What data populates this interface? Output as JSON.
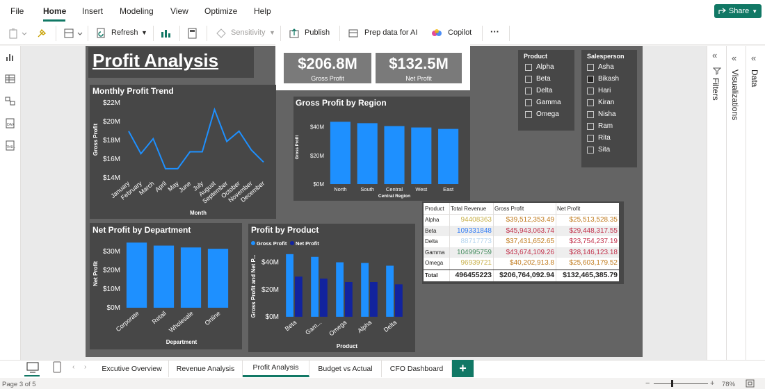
{
  "menu": {
    "items": [
      "File",
      "Home",
      "Insert",
      "Modeling",
      "View",
      "Optimize",
      "Help"
    ],
    "share_label": "Share"
  },
  "toolbar": {
    "refresh_label": "Refresh",
    "sensitivity_label": "Sensitivity",
    "publish_label": "Publish",
    "prep_label": "Prep data for AI",
    "copilot_label": "Copilot",
    "more_label": "···"
  },
  "report": {
    "title": "Profit Analysis",
    "cards": [
      {
        "value": "$206.8M",
        "label": "Gross Profit"
      },
      {
        "value": "$132.5M",
        "label": "Net Profit"
      }
    ],
    "slicer_product": {
      "title": "Product",
      "items": [
        "Alpha",
        "Beta",
        "Delta",
        "Gamma",
        "Omega"
      ]
    },
    "slicer_salesperson": {
      "title": "Salesperson",
      "items": [
        "Asha",
        "Bikash",
        "Hari",
        "Kiran",
        "Nisha",
        "Ram",
        "Rita",
        "Sita"
      ],
      "selected": "Bikash"
    },
    "table": {
      "headers": [
        "Product",
        "Total Revenue",
        "Gross Profit",
        "Net Profit"
      ],
      "rows": [
        [
          "Alpha",
          "94408363",
          "$39,512,353.49",
          "$25,513,528.35"
        ],
        [
          "Beta",
          "109331848",
          "$45,943,063.74",
          "$29,448,317.55"
        ],
        [
          "Delta",
          "88717773",
          "$37,431,652.65",
          "$23,754,237.19"
        ],
        [
          "Gamma",
          "104995759",
          "$43,674,109.26",
          "$28,146,123.18"
        ],
        [
          "Omega",
          "96939721",
          "$40,202,913.8",
          "$25,603,179.52"
        ]
      ],
      "total": [
        "Total",
        "496455223",
        "$206,764,092.94",
        "$132,465,385.79"
      ]
    }
  },
  "chart_data": [
    {
      "type": "line",
      "title": "Monthly Profit Trend",
      "xlabel": "Month",
      "ylabel": "Gross Profit",
      "categories": [
        "January",
        "February",
        "March",
        "April",
        "May",
        "June",
        "July",
        "August",
        "September",
        "October",
        "November",
        "December"
      ],
      "values": [
        18.9,
        16.5,
        18.1,
        14.9,
        14.9,
        16.7,
        16.7,
        21.2,
        17.8,
        18.9,
        16.9,
        15.6
      ],
      "yticks": [
        "$14M",
        "$16M",
        "$18M",
        "$20M",
        "$22M"
      ],
      "ylim": [
        14,
        22
      ]
    },
    {
      "type": "bar",
      "title": "Gross Profit by Region",
      "xlabel": "Central Region",
      "ylabel": "Gross Profit",
      "categories": [
        "North",
        "South",
        "Central",
        "West",
        "East"
      ],
      "values": [
        43.5,
        42.5,
        40.5,
        39.5,
        38.5
      ],
      "yticks": [
        "$0M",
        "$20M",
        "$40M"
      ],
      "ylim": [
        0,
        48
      ]
    },
    {
      "type": "bar",
      "title": "Net Profit by Department",
      "xlabel": "Department",
      "ylabel": "Net Profit",
      "categories": [
        "Corporate",
        "Retail",
        "Wholesale",
        "Online"
      ],
      "values": [
        34.8,
        33.2,
        32.2,
        31.5
      ],
      "yticks": [
        "$0M",
        "$10M",
        "$20M",
        "$30M"
      ],
      "ylim": [
        0,
        36
      ]
    },
    {
      "type": "bar",
      "title": "Profit by Product",
      "xlabel": "Product",
      "ylabel": "Gross Profit and Net P...",
      "categories": [
        "Beta",
        "Gam...",
        "Omega",
        "Alpha",
        "Delta"
      ],
      "series": [
        {
          "name": "Gross Profit",
          "values": [
            46,
            44,
            40,
            39.5,
            37.5
          ]
        },
        {
          "name": "Net Profit",
          "values": [
            29.5,
            28,
            25.5,
            25.5,
            23.8
          ]
        }
      ],
      "yticks": [
        "$0M",
        "$20M",
        "$40M"
      ],
      "ylim": [
        0,
        50
      ]
    }
  ],
  "right_pane": {
    "filters": "Filters",
    "visualizations": "Visualizations",
    "data": "Data"
  },
  "page_tabs": [
    "Excutive Overview",
    "Revenue Analysis",
    "Profit Analysis",
    "Budget vs Actual",
    "CFO Dashboard"
  ],
  "status": {
    "page": "Page 3 of 5",
    "zoom": "78%"
  },
  "colors": {
    "accent": "#117865",
    "bar": "#1e90ff",
    "bar_dark": "#12239e"
  }
}
